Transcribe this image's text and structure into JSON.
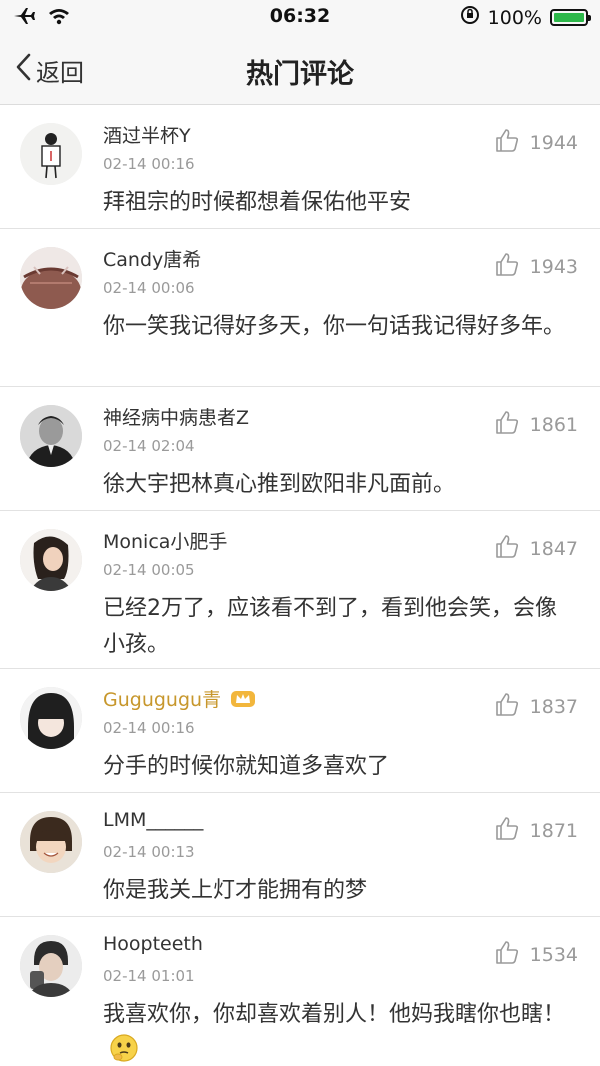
{
  "status_bar": {
    "time": "06:32",
    "battery_text": "100%",
    "battery_level": 1.0,
    "icons": [
      "airplane-icon",
      "wifi-icon",
      "orientation-lock-icon",
      "battery-icon"
    ],
    "battery_color": "#2db84a"
  },
  "nav": {
    "back_label": "返回",
    "title": "热门评论"
  },
  "comments": [
    {
      "user": "酒过半杯Y",
      "time": "02-14 00:16",
      "text": "拜祖宗的时候都想着保佑他平安",
      "likes": "1944"
    },
    {
      "user": "Candy唐希",
      "time": "02-14 00:06",
      "text": "你一笑我记得好多天，你一句话我记得好多年。",
      "likes": "1943"
    },
    {
      "user": "神经病中病患者Z",
      "time": "02-14 02:04",
      "text": "徐大宇把林真心推到欧阳非凡面前。",
      "likes": "1861"
    },
    {
      "user": "Monica小肥手",
      "time": "02-14 00:05",
      "text": "已经2万了，应该看不到了，看到他会笑，会像小孩。",
      "likes": "1847"
    },
    {
      "user": "Gugugugu青",
      "time": "02-14 00:16",
      "text": "分手的时候你就知道多喜欢了",
      "likes": "1837"
    },
    {
      "user": "LMM______",
      "time": "02-14 00:13",
      "text": "你是我关上灯才能拥有的梦",
      "likes": "1871"
    },
    {
      "user": "Hoopteeth",
      "time": "02-14 01:01",
      "text": "我喜欢你，你却喜欢着别人！他妈我瞎你也瞎！",
      "likes": "1534"
    }
  ],
  "colors": {
    "vip_username": "#c7972c",
    "meta_gray": "#9a9a9a"
  }
}
